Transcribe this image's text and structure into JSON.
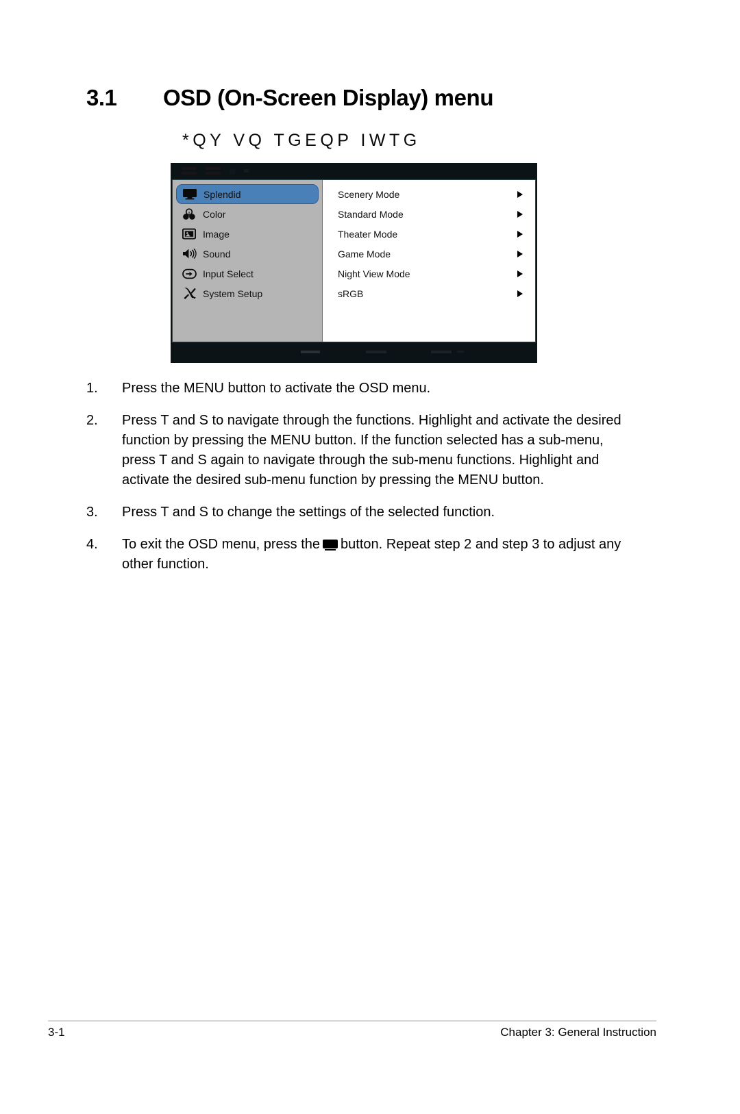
{
  "heading": {
    "number": "3.1",
    "title": "OSD (On-Screen Display) menu",
    "subtitle": "*QY VQ TGEQP IWTG"
  },
  "osd": {
    "sidebar_items": [
      {
        "label": "Splendid",
        "icon": "monitor-icon",
        "selected": true
      },
      {
        "label": "Color",
        "icon": "color-circles-icon",
        "selected": false
      },
      {
        "label": "Image",
        "icon": "picture-frame-icon",
        "selected": false
      },
      {
        "label": "Sound",
        "icon": "speaker-icon",
        "selected": false
      },
      {
        "label": "Input Select",
        "icon": "input-arrow-icon",
        "selected": false
      },
      {
        "label": "System Setup",
        "icon": "tools-icon",
        "selected": false
      }
    ],
    "modes": [
      {
        "label": "Scenery Mode"
      },
      {
        "label": "Standard Mode"
      },
      {
        "label": "Theater Mode"
      },
      {
        "label": "Game Mode"
      },
      {
        "label": "Night View Mode"
      },
      {
        "label": "sRGB"
      }
    ],
    "colors": {
      "highlight": "#4a80b8",
      "sidebar_bg": "#b5b5b5",
      "bezel": "#0b1316",
      "content_bg": "#ffffff"
    }
  },
  "steps": [
    {
      "number": "1.",
      "text": "Press the MENU button to activate the OSD menu."
    },
    {
      "number": "2.",
      "text": "Press  T and  S to navigate through the functions. Highlight and activate the desired function by pressing the MENU button. If the function selected has a sub-menu, press  T and  S again to navigate through the sub-menu functions. Highlight and activate the desired sub-menu function by pressing the MENU button."
    },
    {
      "number": "3.",
      "text": "Press  T and  S to change the settings of the selected function."
    },
    {
      "number": "4.",
      "text_before": "To exit the OSD menu, press the",
      "text_after": "button. Repeat step 2 and step 3 to adjust any other function."
    }
  ],
  "footer": {
    "page_number": "3-1",
    "chapter": "Chapter 3: General Instruction"
  }
}
